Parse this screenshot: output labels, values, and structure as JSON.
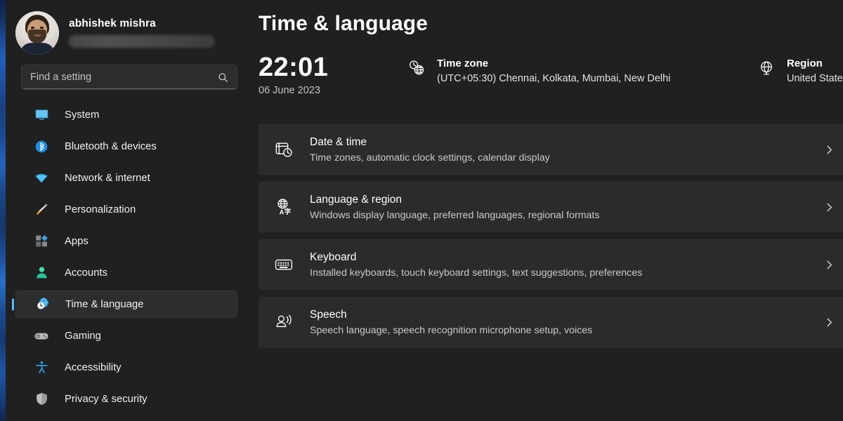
{
  "account": {
    "name": "abhishek mishra",
    "email_redacted": true,
    "avatar_icon": "user-avatar-photo"
  },
  "search": {
    "placeholder": "Find a setting",
    "value": "",
    "icon": "search-icon"
  },
  "sidebar": {
    "items": [
      {
        "label": "System",
        "icon": "monitor-icon",
        "selected": false
      },
      {
        "label": "Bluetooth & devices",
        "icon": "bluetooth-icon",
        "selected": false
      },
      {
        "label": "Network & internet",
        "icon": "wifi-icon",
        "selected": false
      },
      {
        "label": "Personalization",
        "icon": "paintbrush-icon",
        "selected": false
      },
      {
        "label": "Apps",
        "icon": "apps-icon",
        "selected": false
      },
      {
        "label": "Accounts",
        "icon": "person-icon",
        "selected": false
      },
      {
        "label": "Time & language",
        "icon": "clock-globe-icon",
        "selected": true
      },
      {
        "label": "Gaming",
        "icon": "gamepad-icon",
        "selected": false
      },
      {
        "label": "Accessibility",
        "icon": "accessibility-icon",
        "selected": false
      },
      {
        "label": "Privacy & security",
        "icon": "shield-icon",
        "selected": false
      }
    ]
  },
  "main": {
    "title": "Time & language",
    "clock": {
      "time": "22:01",
      "date": "06 June 2023"
    },
    "timezone": {
      "label": "Time zone",
      "value": "(UTC+05:30) Chennai, Kolkata, Mumbai, New Delhi",
      "icon": "clock-globe-icon"
    },
    "region": {
      "label": "Region",
      "value": "United States",
      "icon": "globe-icon"
    },
    "cards": [
      {
        "title": "Date & time",
        "subtitle": "Time zones, automatic clock settings, calendar display",
        "icon": "calendar-clock-icon",
        "chevron": "chevron-right-icon"
      },
      {
        "title": "Language & region",
        "subtitle": "Windows display language, preferred languages, regional formats",
        "icon": "translate-globe-icon",
        "chevron": "chevron-right-icon"
      },
      {
        "title": "Keyboard",
        "subtitle": "Installed keyboards, touch keyboard settings, text suggestions, preferences",
        "icon": "keyboard-icon",
        "chevron": "chevron-right-icon"
      },
      {
        "title": "Speech",
        "subtitle": "Speech language, speech recognition microphone setup, voices",
        "icon": "speech-person-icon",
        "chevron": "chevron-right-icon"
      }
    ]
  },
  "colors": {
    "accent": "#4cc2ff",
    "page_background": "#202020",
    "card_background": "#2b2b2b",
    "selected_background": "#2d2d2d"
  }
}
